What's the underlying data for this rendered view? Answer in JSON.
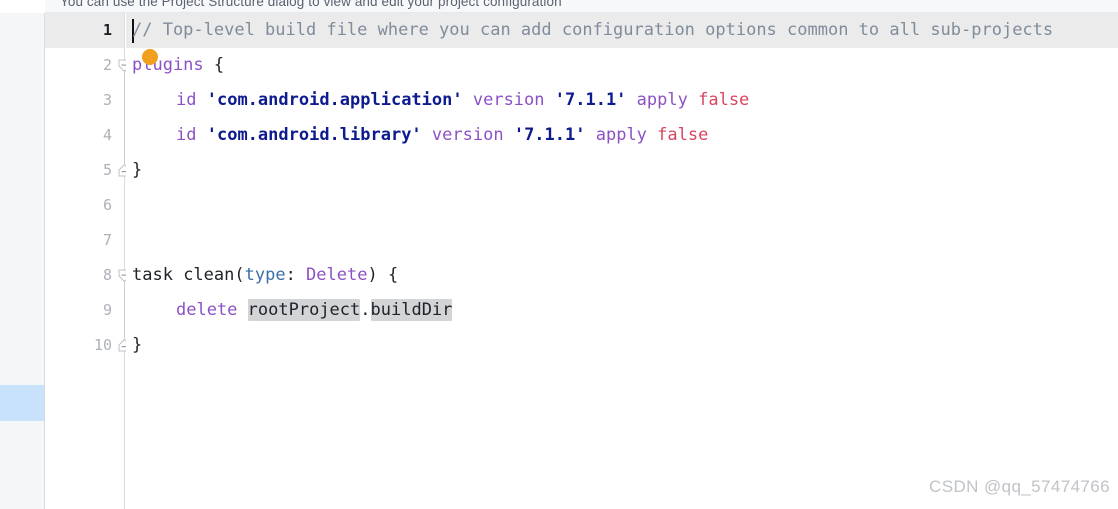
{
  "banner": {
    "message": "You can use the Project Structure dialog to view and edit your project configuration"
  },
  "editor": {
    "active_line": 1,
    "caret_line": 1,
    "caret_column": 1,
    "gutter": {
      "line_numbers": [
        "1",
        "2",
        "3",
        "4",
        "5",
        "6",
        "7",
        "8",
        "9",
        "10"
      ],
      "run_arrow_line": 8,
      "run_arrow_icon": "run-triangle-icon",
      "fold_open_lines": [
        2,
        8
      ],
      "fold_close_lines": [
        5,
        10
      ]
    },
    "intention_bulb_icon": "lightbulb-icon",
    "left_marker_icon": "changed-lines-marker",
    "lines": [
      {
        "n": 1,
        "indent": 0,
        "tokens": [
          {
            "t": "// Top-level build file where you can add configuration options common to all sub-projects",
            "c": "tok-comment"
          }
        ]
      },
      {
        "n": 2,
        "indent": 0,
        "tokens": [
          {
            "t": "plugins",
            "c": "tok-keyword"
          },
          {
            "t": " {",
            "c": "tok-punct"
          }
        ]
      },
      {
        "n": 3,
        "indent": 1,
        "tokens": [
          {
            "t": "id",
            "c": "tok-keyword"
          },
          {
            "t": " ",
            "c": "tok-plain"
          },
          {
            "t": "'com.android.application'",
            "c": "tok-string"
          },
          {
            "t": " ",
            "c": "tok-plain"
          },
          {
            "t": "version",
            "c": "tok-keyword"
          },
          {
            "t": " ",
            "c": "tok-plain"
          },
          {
            "t": "'7.1.1'",
            "c": "tok-string"
          },
          {
            "t": " ",
            "c": "tok-plain"
          },
          {
            "t": "apply",
            "c": "tok-keyword"
          },
          {
            "t": " ",
            "c": "tok-plain"
          },
          {
            "t": "false",
            "c": "tok-bool"
          }
        ]
      },
      {
        "n": 4,
        "indent": 1,
        "tokens": [
          {
            "t": "id",
            "c": "tok-keyword"
          },
          {
            "t": " ",
            "c": "tok-plain"
          },
          {
            "t": "'com.android.library'",
            "c": "tok-string"
          },
          {
            "t": " ",
            "c": "tok-plain"
          },
          {
            "t": "version",
            "c": "tok-keyword"
          },
          {
            "t": " ",
            "c": "tok-plain"
          },
          {
            "t": "'7.1.1'",
            "c": "tok-string"
          },
          {
            "t": " ",
            "c": "tok-plain"
          },
          {
            "t": "apply",
            "c": "tok-keyword"
          },
          {
            "t": " ",
            "c": "tok-plain"
          },
          {
            "t": "false",
            "c": "tok-bool"
          }
        ]
      },
      {
        "n": 5,
        "indent": 0,
        "tokens": [
          {
            "t": "}",
            "c": "tok-punct"
          }
        ]
      },
      {
        "n": 6,
        "indent": 0,
        "tokens": []
      },
      {
        "n": 7,
        "indent": 0,
        "tokens": []
      },
      {
        "n": 8,
        "indent": 0,
        "tokens": [
          {
            "t": "task",
            "c": "tok-kw-dark"
          },
          {
            "t": " clean(",
            "c": "tok-plain"
          },
          {
            "t": "type",
            "c": "tok-param"
          },
          {
            "t": ": ",
            "c": "tok-plain"
          },
          {
            "t": "Delete",
            "c": "tok-type"
          },
          {
            "t": ") {",
            "c": "tok-punct"
          }
        ]
      },
      {
        "n": 9,
        "indent": 1,
        "tokens": [
          {
            "t": "delete",
            "c": "tok-keyword"
          },
          {
            "t": " ",
            "c": "tok-plain"
          },
          {
            "t": "rootProject",
            "c": "tok-plain",
            "hl": true
          },
          {
            "t": ".",
            "c": "tok-plain"
          },
          {
            "t": "buildDir",
            "c": "tok-plain",
            "hl": true
          }
        ]
      },
      {
        "n": 10,
        "indent": 0,
        "tokens": [
          {
            "t": "}",
            "c": "tok-punct"
          }
        ]
      }
    ]
  },
  "watermark": {
    "text": "CSDN @qq_57474766"
  },
  "colors": {
    "active_line": "#ebebeb",
    "comment": "#7f8c9b",
    "keyword": "#8c51c4",
    "string": "#0d1b8e",
    "boolean": "#d9455f",
    "parameter": "#3a6ea8",
    "run_arrow": "#4f9e62",
    "bulb": "#f0a01e",
    "left_marker": "#c8e2fb",
    "gutter_bg": "#f5f6f8"
  }
}
